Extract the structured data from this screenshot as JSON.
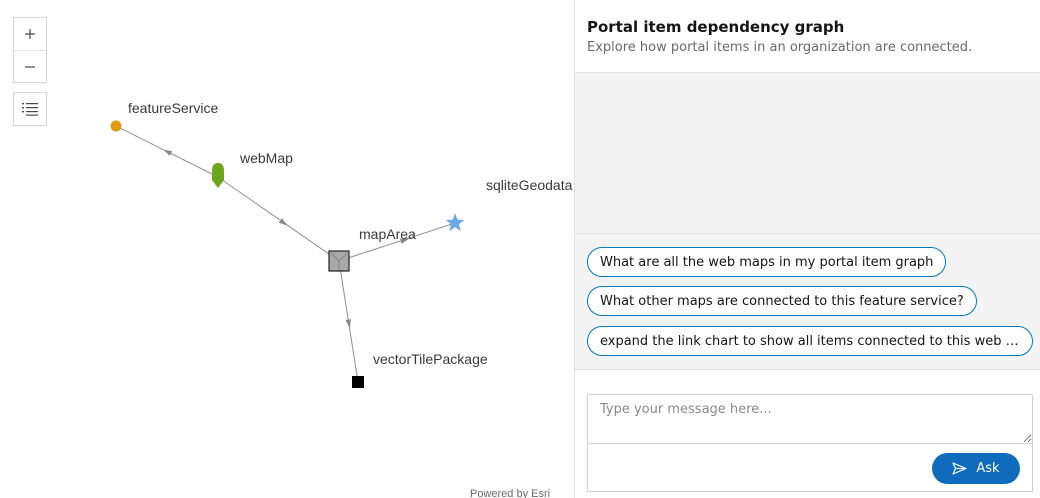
{
  "map": {
    "controls": {
      "zoom_in": {
        "label": "+",
        "icon": "plus-icon"
      },
      "zoom_out": {
        "label": "−",
        "icon": "minus-icon"
      },
      "legend": {
        "icon": "list-icon"
      }
    },
    "graph": {
      "nodes": [
        {
          "id": "featureService",
          "label": "featureService",
          "shape": "circle",
          "color": "#e39a0e"
        },
        {
          "id": "webMap",
          "label": "webMap",
          "shape": "pin",
          "color": "#6da61b"
        },
        {
          "id": "mapArea",
          "label": "mapArea",
          "shape": "square",
          "color": "#a8a8a8"
        },
        {
          "id": "sqliteGeodatabase",
          "label": "sqliteGeodata",
          "shape": "star",
          "color": "#6aa8e8"
        },
        {
          "id": "vectorTilePackage",
          "label": "vectorTilePackage",
          "shape": "square",
          "color": "#000000"
        }
      ],
      "edges": [
        {
          "from": "webMap",
          "to": "featureService"
        },
        {
          "from": "webMap",
          "to": "mapArea"
        },
        {
          "from": "mapArea",
          "to": "sqliteGeodatabase"
        },
        {
          "from": "mapArea",
          "to": "vectorTilePackage"
        }
      ],
      "edge_color": "#8f8f8f"
    },
    "attribution": "Powered by Esri"
  },
  "panel": {
    "title": "Portal item dependency graph",
    "subtitle": "Explore how portal items in an organization are connected.",
    "suggestions": [
      "What are all the web maps in my portal item graph",
      "What other maps are connected to this feature service?",
      "expand the link chart to show all items connected to this web map"
    ],
    "input": {
      "placeholder": "Type your message here...",
      "value": ""
    },
    "ask_button": {
      "label": "Ask",
      "icon": "send-icon"
    }
  },
  "colors": {
    "accent": "#007ac2",
    "ask_button": "#0f6cbd",
    "panel_background": "#f3f3f3"
  }
}
